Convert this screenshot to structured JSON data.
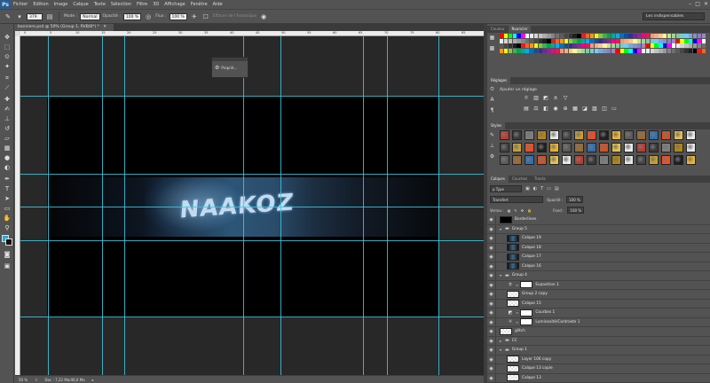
{
  "app_logo": "Ps",
  "menu": [
    "Fichier",
    "Edition",
    "Image",
    "Calque",
    "Texte",
    "Sélection",
    "Filtre",
    "3D",
    "Affichage",
    "Fenêtre",
    "Aide"
  ],
  "options": {
    "size_value": "379",
    "mode_label": "Mode :",
    "mode_value": "Normal",
    "opacity_label": "Opacité :",
    "opacity_value": "100 %",
    "flow_label": "Flux :",
    "flow_value": "100 %",
    "erase_history": "Effacer de l'historique",
    "workspace": "Les indispensables"
  },
  "document": {
    "tab_title": "banniere.psd @ 50% (Group 1, RVB/8*) *",
    "zoom": "50 %",
    "doc_size": "Doc : 7,22 Mo/46,0 Mo",
    "banner_text": "NAAKOZ"
  },
  "properties_float": {
    "label": "Proprié..."
  },
  "panels": {
    "swatches_tabs": [
      "Couleur",
      "Nuancier"
    ],
    "adjustments_tab": "Réglages",
    "adjustments_title": "Ajouter un réglage",
    "styles_tab": "Styles",
    "layers_tabs": [
      "Calques",
      "Couches",
      "Tracés"
    ],
    "filter_value": "ρ Type",
    "blend_mode": "Transfert",
    "opacity_label": "Opacité :",
    "opacity_value": "100 %",
    "lock_label": "Verrou :",
    "fill_label": "Fond :",
    "fill_value": "100 %"
  },
  "layers": [
    {
      "name": "Borderlines",
      "kind": "layer",
      "thumb": "black",
      "indent": 0
    },
    {
      "name": "Group 5",
      "kind": "group",
      "indent": 0
    },
    {
      "name": "Calque 19",
      "kind": "layer",
      "thumb": "art",
      "indent": 1
    },
    {
      "name": "Calque 18",
      "kind": "layer",
      "thumb": "art",
      "indent": 1
    },
    {
      "name": "Calque 17",
      "kind": "layer",
      "thumb": "art",
      "indent": 1
    },
    {
      "name": "Calque 16",
      "kind": "layer",
      "thumb": "art",
      "indent": 1
    },
    {
      "name": "Group 4",
      "kind": "group",
      "indent": 0
    },
    {
      "name": "Exposition 1",
      "kind": "adjustment",
      "glyph": "±",
      "indent": 1
    },
    {
      "name": "Group 2 copy",
      "kind": "layer",
      "thumb": "checker",
      "indent": 1
    },
    {
      "name": "Calque 15",
      "kind": "layer",
      "thumb": "checker",
      "indent": 1
    },
    {
      "name": "Courbes 1",
      "kind": "adjustment",
      "glyph": "◩",
      "indent": 1
    },
    {
      "name": "Luminosité/Contraste 1",
      "kind": "adjustment",
      "glyph": "☼",
      "indent": 1
    },
    {
      "name": "glitch",
      "kind": "layer",
      "thumb": "checker",
      "indent": 0
    },
    {
      "name": "CC",
      "kind": "group",
      "indent": 0,
      "collapsed": true
    },
    {
      "name": "Group 1",
      "kind": "group",
      "indent": 0
    },
    {
      "name": "Layer 106 copy",
      "kind": "layer",
      "thumb": "checker",
      "indent": 1
    },
    {
      "name": "Calque 13 copie",
      "kind": "layer",
      "thumb": "checker",
      "indent": 1
    },
    {
      "name": "Calque 13",
      "kind": "layer",
      "thumb": "checker",
      "indent": 1
    }
  ],
  "ruler_ticks": [
    "0",
    "5",
    "10",
    "15",
    "20",
    "25",
    "30",
    "35",
    "40",
    "45",
    "50",
    "55",
    "60",
    "65",
    "70",
    "75",
    "80",
    "85"
  ],
  "swatch_colors": [
    "#ff0000",
    "#ffff00",
    "#00ff00",
    "#00ffff",
    "#0000ff",
    "#ff00ff",
    "#ffffff",
    "#ebebeb",
    "#d6d6d6",
    "#c2c2c2",
    "#adadad",
    "#999999",
    "#858585",
    "#707070",
    "#5c5c5c",
    "#474747",
    "#333333",
    "#1f1f1f",
    "#000000",
    "#ed1c24",
    "#f26522",
    "#f7941d",
    "#fff200",
    "#8dc63f",
    "#39b54a",
    "#00a651",
    "#00a99d",
    "#00aeef",
    "#0072bc",
    "#0054a6",
    "#2e3192",
    "#662d91",
    "#92278f",
    "#ec008c",
    "#ed145b",
    "#f69679",
    "#f9ad81",
    "#fdc68a",
    "#fff799",
    "#c4df9b",
    "#a3d39c",
    "#82ca9c",
    "#7accc8",
    "#6dcff6",
    "#7da7d9",
    "#8393ca",
    "#8781bd",
    "#a186be"
  ],
  "style_colors": [
    "#c0392b",
    "#3a3a3a",
    "#7f7f7f",
    "#b8860b",
    "#e8e8e8",
    "#444",
    "#c9a227",
    "#ff4a1a",
    "#1e1e1e",
    "#f0b429",
    "#5b5b5b",
    "#9c6b2f",
    "#2d6fb5",
    "#d94f1e",
    "#e6c34a",
    "#ececec"
  ]
}
